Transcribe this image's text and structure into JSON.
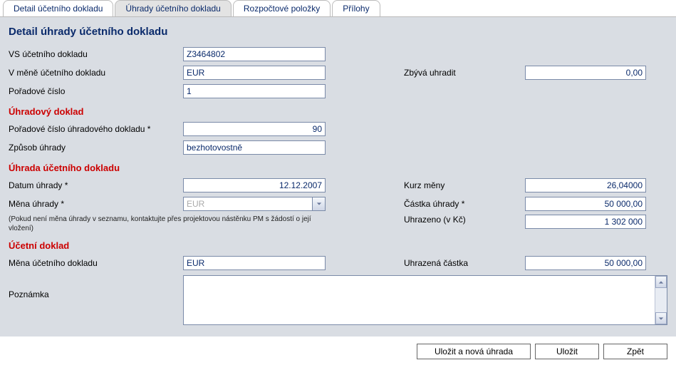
{
  "tabs": {
    "detail": "Detail účetního dokladu",
    "uhrady": "Úhrady účetního dokladu",
    "rozpoctove": "Rozpočtové položky",
    "prilohy": "Přílohy"
  },
  "page_title": "Detail úhrady účetního dokladu",
  "general": {
    "vs_label": "VS účetního dokladu",
    "vs_value": "Z3464802",
    "mena_label": "V měně účetního dokladu",
    "mena_value": "EUR",
    "zbyva_label": "Zbývá uhradit",
    "zbyva_value": "0,00",
    "poradi_label": "Pořadové číslo",
    "poradi_value": "1"
  },
  "sections": {
    "uhradovy": "Úhradový doklad",
    "uhrada": "Úhrada účetního dokladu",
    "ucetni": "Účetní doklad"
  },
  "uhradovy": {
    "poradi_label": "Pořadové číslo úhradového dokladu *",
    "poradi_value": "90",
    "zpusob_label": "Způsob úhrady",
    "zpusob_value": "bezhotovostně"
  },
  "uhrada": {
    "datum_label": "Datum úhrady *",
    "datum_value": "12.12.2007",
    "kurz_label": "Kurz měny",
    "kurz_value": "26,04000",
    "mena_label": "Měna úhrady *",
    "mena_value": "EUR",
    "castka_label": "Částka úhrady *",
    "castka_value": "50 000,00",
    "uhrazeno_label": "Uhrazeno (v Kč)",
    "uhrazeno_value": "1 302 000",
    "note": "(Pokud není měna úhrady v seznamu, kontaktujte přes projektovou nástěnku PM s žádostí o její vložení)"
  },
  "ucetni": {
    "mena_label": "Měna účetního dokladu",
    "mena_value": "EUR",
    "uhrazena_label": "Uhrazená částka",
    "uhrazena_value": "50 000,00",
    "poznamka_label": "Poznámka",
    "poznamka_value": ""
  },
  "buttons": {
    "save_new": "Uložit a nová úhrada",
    "save": "Uložit",
    "back": "Zpět"
  }
}
